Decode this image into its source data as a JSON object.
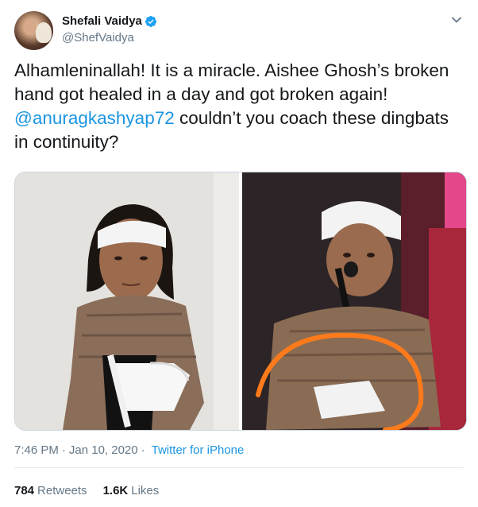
{
  "author": {
    "name": "Shefali Vaidya",
    "handle": "@ShefVaidya",
    "verified": true
  },
  "tweet": {
    "text_before": "Alhamleninallah! It is a miracle. Aishee Ghosh’s broken hand got healed in a day and got broken again!\n",
    "mention": "@anuragkashyap72",
    "text_after": " couldn’t you coach these dingbats in continuity?"
  },
  "meta": {
    "time": "7:46 PM",
    "separator": "·",
    "date": "Jan 10, 2020",
    "source": "Twitter for iPhone"
  },
  "stats": {
    "retweets_count": "784",
    "retweets_label": "Retweets",
    "likes_count": "1.6K",
    "likes_label": "Likes"
  },
  "colors": {
    "link": "#1b95e0",
    "secondary_text": "#657786",
    "verified_badge": "#1da1f2",
    "annotation_circle": "#ff7a1a"
  },
  "icons": {
    "verified": "verified-badge-icon",
    "menu": "chevron-down-icon"
  }
}
